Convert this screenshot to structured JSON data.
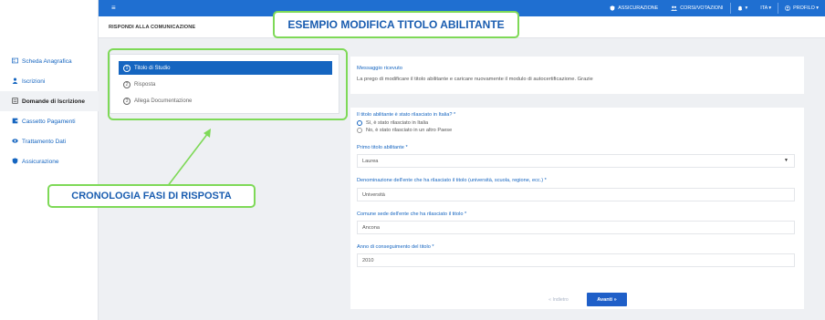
{
  "sidebar": {
    "items": [
      {
        "label": "Scheda Anagrafica",
        "icon": "id-card-icon"
      },
      {
        "label": "Iscrizioni",
        "icon": "user-icon"
      },
      {
        "label": "Domande di Iscrizione",
        "icon": "document-icon"
      },
      {
        "label": "Cassetto Pagamenti",
        "icon": "wallet-icon"
      },
      {
        "label": "Trattamento Dati",
        "icon": "eye-icon"
      },
      {
        "label": "Assicurazione",
        "icon": "shield-icon"
      }
    ],
    "active_index": 2
  },
  "topbar": {
    "menu_icon": "hamburger-icon",
    "nav": [
      {
        "label": "ASSICURAZIONE",
        "icon": "shield-icon"
      },
      {
        "label": "CORSI/VOTAZIONI",
        "icon": "users-icon"
      },
      {
        "label": "▾",
        "icon": "bell-icon"
      },
      {
        "label": "ITA ▾",
        "icon": ""
      },
      {
        "label": "PROFILO ▾",
        "icon": "profile-icon"
      }
    ],
    "color": "#1f6fd1"
  },
  "breadcrumb": "RISPONDI ALLA COMUNICAZIONE",
  "steps": [
    {
      "num": "1",
      "label": "Titolo di Studio",
      "active": true
    },
    {
      "num": "2",
      "label": "Risposta",
      "active": false
    },
    {
      "num": "3",
      "label": "Allega Documentazione",
      "active": false
    }
  ],
  "message": {
    "title": "Messaggio ricevuto",
    "body": "La prego di modificare il titolo abilitante e caricare nuovamente il modulo di autocertificazione. Grazie"
  },
  "form": {
    "q_italy": "Il titolo abilitante è stato rilasciato in Italia? *",
    "opt_yes": "Sì, è stato rilasciato in Italia",
    "opt_no": "No, è stato rilasciato in un altro Paese",
    "selected": "yes",
    "primo_label": "Primo titolo abilitante *",
    "primo_value": "Laurea",
    "ente_label": "Denominazione dell'ente che ha rilasciato il titolo (università, scuola, regione, ecc.) *",
    "ente_value": "Università",
    "comune_label": "Comune sede dell'ente che ha rilasciato il titolo *",
    "comune_value": "Ancona",
    "anno_label": "Anno di conseguimento del titolo *",
    "anno_value": "2010",
    "prev_label": "« Indietro",
    "next_label": "Avanti »"
  },
  "annotations": {
    "title_label": "ESEMPIO MODIFICA TITOLO ABILITANTE",
    "steps_label": "CRONOLOGIA FASI DI RISPOSTA",
    "color": "#7ed957"
  }
}
